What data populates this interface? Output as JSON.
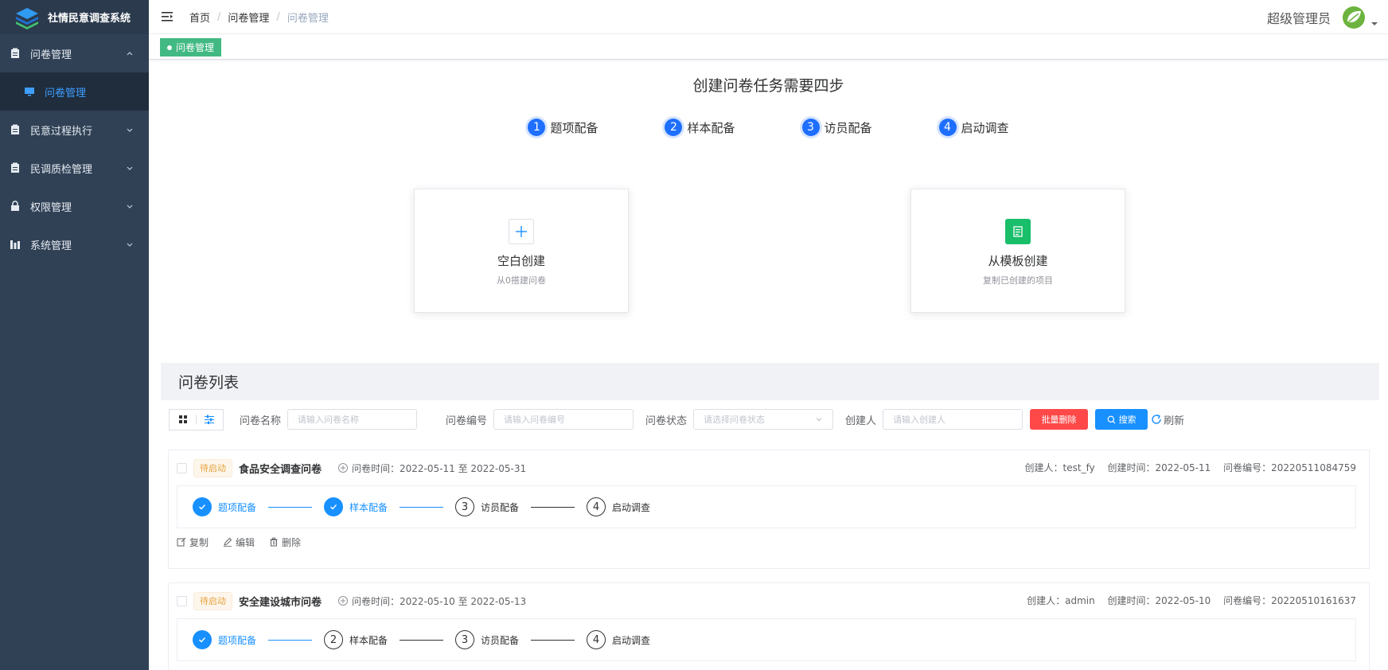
{
  "app": {
    "title": "社情民意调查系统"
  },
  "sidebar": {
    "items": [
      {
        "label": "问卷管理",
        "expanded": true,
        "children": [
          {
            "label": "问卷管理",
            "active": true
          }
        ]
      },
      {
        "label": "民意过程执行"
      },
      {
        "label": "民调质检管理"
      },
      {
        "label": "权限管理"
      },
      {
        "label": "系统管理"
      }
    ]
  },
  "header": {
    "breadcrumb": [
      "首页",
      "问卷管理",
      "问卷管理"
    ],
    "user_name": "超级管理员"
  },
  "tags": {
    "active": "问卷管理"
  },
  "create": {
    "title": "创建问卷任务需要四步",
    "steps": [
      {
        "num": "1",
        "label": "题项配备"
      },
      {
        "num": "2",
        "label": "样本配备"
      },
      {
        "num": "3",
        "label": "访员配备"
      },
      {
        "num": "4",
        "label": "启动调查"
      }
    ],
    "blank": {
      "title": "空白创建",
      "sub": "从0搭建问卷"
    },
    "template": {
      "title": "从模板创建",
      "sub": "复制已创建的项目"
    }
  },
  "list": {
    "title": "问卷列表",
    "filters": {
      "name_label": "问卷名称",
      "name_placeholder": "请输入问卷名称",
      "code_label": "问卷编号",
      "code_placeholder": "请输入问卷编号",
      "status_label": "问卷状态",
      "status_placeholder": "请选择问卷状态",
      "creator_label": "创建人",
      "creator_placeholder": "请输入创建人",
      "batch_delete": "批量删除",
      "search": "搜索",
      "refresh": "刷新"
    },
    "actions": {
      "copy": "复制",
      "edit": "编辑",
      "delete": "删除"
    },
    "items": [
      {
        "status": "待启动",
        "title": "食品安全调查问卷",
        "time": "问卷时间：2022-05-11 至 2022-05-31",
        "creator": "创建人：test_fy",
        "created": "创建时间：2022-05-11",
        "code": "问卷编号：20220511084759",
        "steps": [
          {
            "num": "1",
            "label": "题项配备",
            "done": true
          },
          {
            "num": "2",
            "label": "样本配备",
            "done": true
          },
          {
            "num": "3",
            "label": "访员配备",
            "done": false
          },
          {
            "num": "4",
            "label": "启动调查",
            "done": false
          }
        ]
      },
      {
        "status": "待启动",
        "title": "安全建设城市问卷",
        "time": "问卷时间：2022-05-10 至 2022-05-13",
        "creator": "创建人：admin",
        "created": "创建时间：2022-05-10",
        "code": "问卷编号：20220510161637",
        "steps": [
          {
            "num": "1",
            "label": "题项配备",
            "done": true
          },
          {
            "num": "2",
            "label": "样本配备",
            "done": false
          },
          {
            "num": "3",
            "label": "访员配备",
            "done": false
          },
          {
            "num": "4",
            "label": "启动调查",
            "done": false
          }
        ]
      }
    ]
  },
  "colors": {
    "sidebar_bg": "#304156",
    "primary": "#1890ff",
    "success": "#42b983",
    "danger": "#ff4949",
    "warning": "#e6a23c"
  }
}
